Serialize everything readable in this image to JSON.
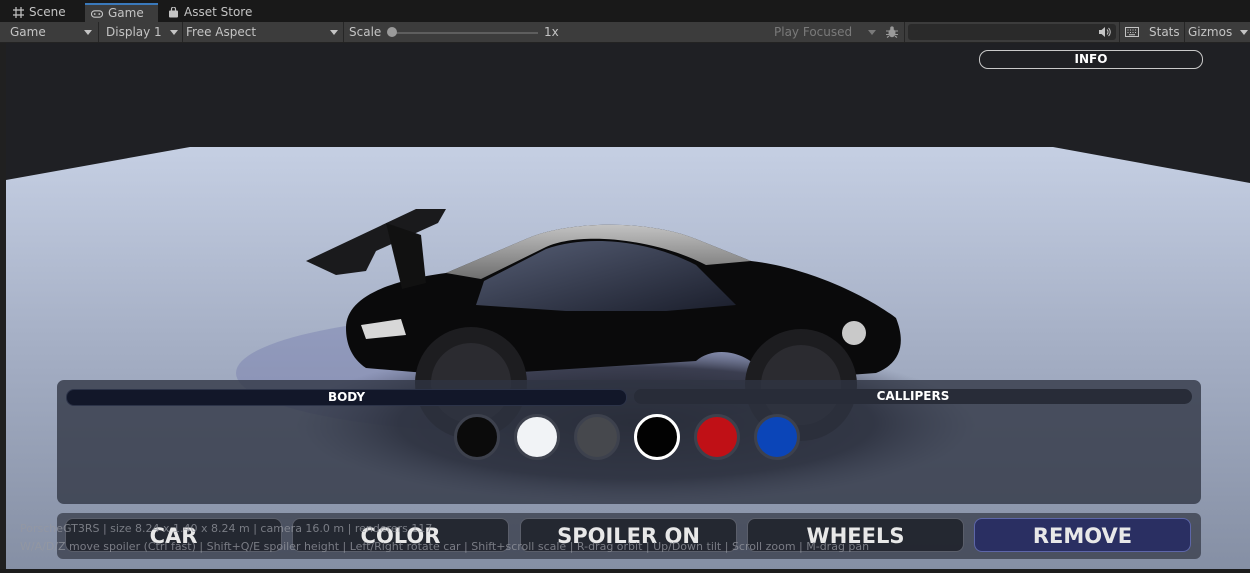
{
  "tabs": [
    {
      "label": "Scene",
      "icon": "grid-icon"
    },
    {
      "label": "Game",
      "icon": "gamepad-icon",
      "active": true
    },
    {
      "label": "Asset Store",
      "icon": "store-bag-icon"
    }
  ],
  "toolbar": {
    "game_view": "Game",
    "display": "Display 1",
    "aspect": "Free Aspect",
    "scale_label": "Scale",
    "scale_value": "1x",
    "scale_fraction": 0.0,
    "play_mode": "Play Focused",
    "stats": "Stats",
    "gizmos": "Gizmos",
    "icons": [
      "bug-icon",
      "speaker-icon",
      "keyboard-icon"
    ]
  },
  "game": {
    "info_button": "INFO",
    "color_panel": {
      "tabs": [
        "BODY",
        "CALLIPERS"
      ],
      "active_tab": "BODY",
      "swatches": [
        {
          "color": "#0b0b0b",
          "selected": false
        },
        {
          "color": "#f1f3f6",
          "selected": false
        },
        {
          "color": "#46484d",
          "selected": false
        },
        {
          "color": "#020202",
          "selected": true
        },
        {
          "color": "#c01016",
          "selected": false
        },
        {
          "color": "#0b45b8",
          "selected": false
        }
      ]
    },
    "bottom_buttons": [
      "CAR",
      "COLOR",
      "SPOILER ON",
      "WHEELS",
      "REMOVE"
    ],
    "hud_line1": "PorscheGT3RS  |  size 8.24 x 1.40 x 8.24 m  |  camera 16.0 m  |  renderers 117",
    "hud_line2": "W/A/D/Z move spoiler (Ctrl fast) | Shift+Q/E spoiler height | Left/Right rotate car | Shift+scroll scale | R-drag orbit | Up/Down tilt | Scroll zoom | M-drag pan"
  },
  "colors": {
    "accent": "#3a79bb",
    "panel": "#303442",
    "remove_button": "#2a2f62"
  }
}
